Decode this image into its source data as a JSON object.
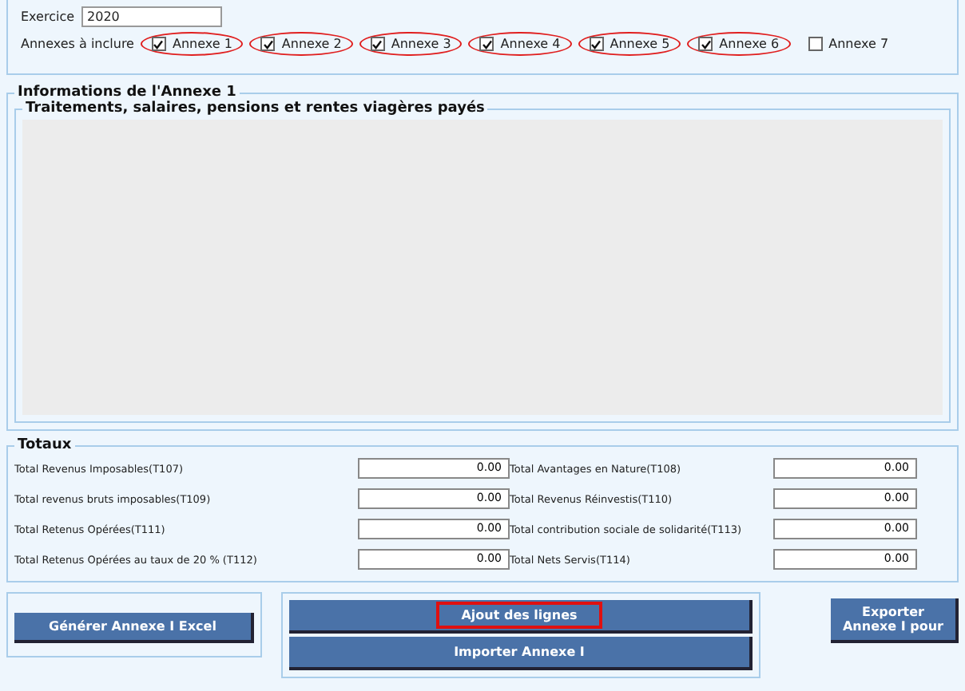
{
  "exercice": {
    "label": "Exercice",
    "value": "2020"
  },
  "annexes": {
    "label": "Annexes à inclure",
    "items": [
      {
        "label": "Annexe 1",
        "checked": true,
        "circled": true
      },
      {
        "label": "Annexe 2",
        "checked": true,
        "circled": true
      },
      {
        "label": "Annexe 3",
        "checked": true,
        "circled": true
      },
      {
        "label": "Annexe 4",
        "checked": true,
        "circled": true
      },
      {
        "label": "Annexe 5",
        "checked": true,
        "circled": true
      },
      {
        "label": "Annexe 6",
        "checked": true,
        "circled": true
      },
      {
        "label": "Annexe 7",
        "checked": false,
        "circled": false
      }
    ]
  },
  "annexe_info": {
    "title": "Informations de l'Annexe 1",
    "subtitle": "Traitements, salaires, pensions et rentes viagères payés"
  },
  "totaux": {
    "title": "Totaux",
    "rows": [
      [
        {
          "label": "Total Revenus Imposables(T107)",
          "value": "0.00"
        },
        {
          "label": "Total Avantages en Nature(T108)",
          "value": "0.00"
        }
      ],
      [
        {
          "label": "Total revenus bruts imposables(T109)",
          "value": "0.00"
        },
        {
          "label": "Total Revenus Réinvestis(T110)",
          "value": "0.00"
        }
      ],
      [
        {
          "label": "Total Retenus Opérées(T111)",
          "value": "0.00"
        },
        {
          "label": "Total contribution sociale de solidarité(T113)",
          "value": "0.00"
        }
      ],
      [
        {
          "label": "Total Retenus Opérées au taux de 20 % (T112)",
          "value": "0.00"
        },
        {
          "label": "Total Nets Servis(T114)",
          "value": "0.00"
        }
      ]
    ]
  },
  "buttons": {
    "generate": "Générer Annexe I Excel",
    "middle": [
      {
        "label": "Ajout des lignes",
        "highlighted": true
      },
      {
        "label": "Importer Annexe I",
        "highlighted": false
      }
    ],
    "export": [
      "Exporter",
      "Annexe I pour"
    ]
  }
}
